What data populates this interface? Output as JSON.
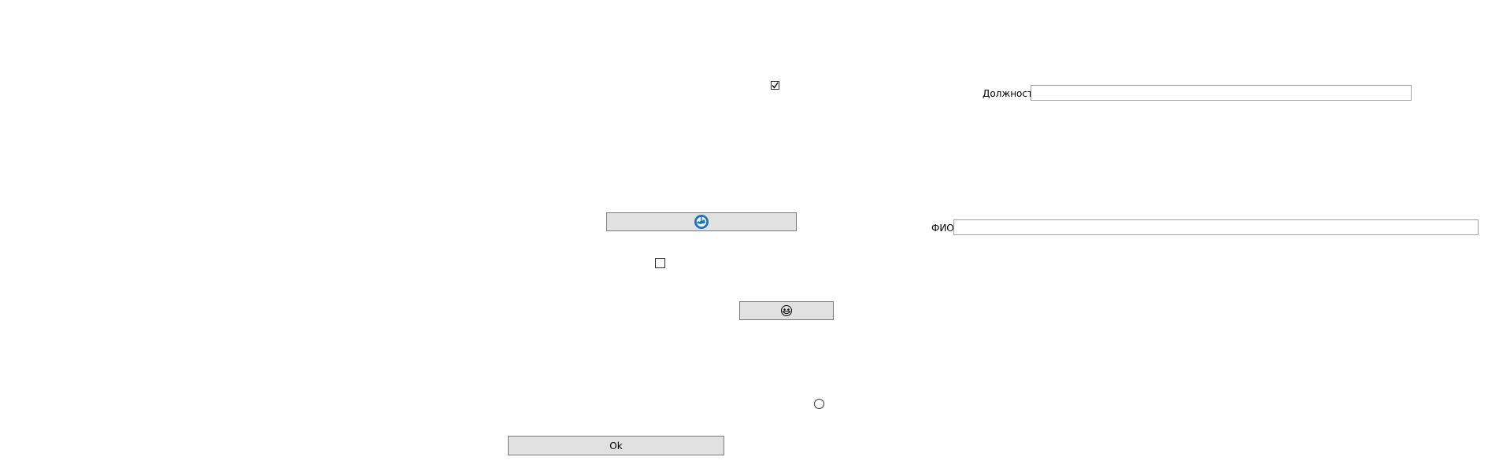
{
  "form": {
    "checkbox_top": {
      "checked": true
    },
    "checkbox_middle": {
      "checked": false
    },
    "radio_bottom": {
      "selected": false
    },
    "globe_button": {
      "icon": "globe-icon",
      "icon_color": "#1a73c8"
    },
    "face_button": {
      "icon": "smiley-face-icon"
    },
    "ok_button": {
      "label": "Ok"
    },
    "position_field": {
      "label": "Должность",
      "value": ""
    },
    "fio_field": {
      "label": "ФИО",
      "value": ""
    }
  }
}
